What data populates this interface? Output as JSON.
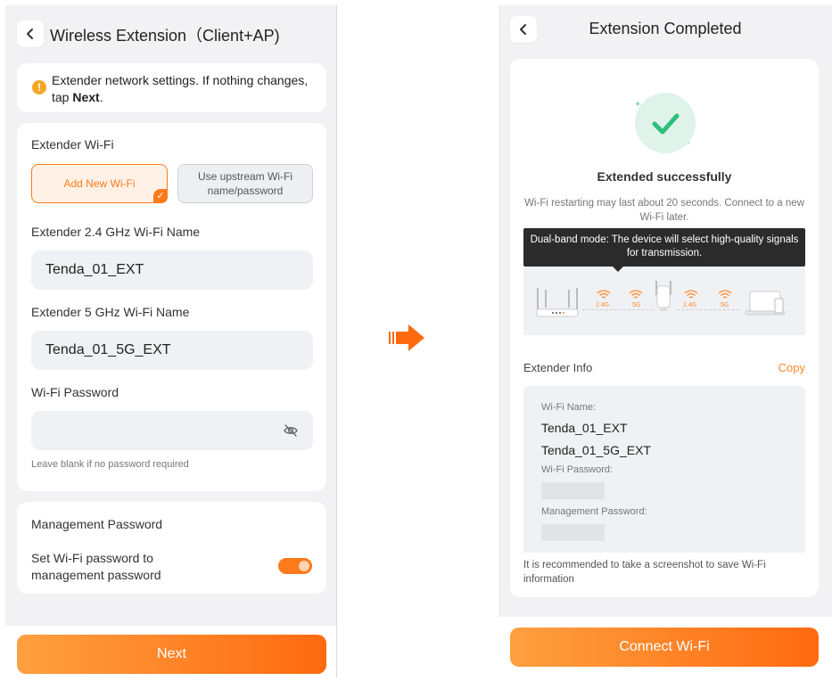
{
  "left_screen": {
    "title": "Wireless Extension（Client+AP)",
    "notice_text": "Extender network settings. If nothing changes, tap ",
    "notice_bold": "Next",
    "notice_end": ".",
    "extender_wifi_label": "Extender Wi-Fi",
    "option_add_new": "Add New Wi-Fi",
    "option_use_upstream": "Use upstream Wi-Fi name/password",
    "name_24_label": "Extender 2.4 GHz Wi-Fi Name",
    "name_24_value": "Tenda_01_EXT",
    "name_5_label": "Extender 5 GHz Wi-Fi Name",
    "name_5_value": "Tenda_01_5G_EXT",
    "password_label": "Wi-Fi Password",
    "password_value": "",
    "password_hint": "Leave blank if no password required",
    "mgmt_title": "Management Password",
    "mgmt_toggle_label": "Set Wi-Fi password to management password",
    "mgmt_toggle_on": true,
    "next_button": "Next"
  },
  "right_screen": {
    "title": "Extension Completed",
    "success_title": "Extended successfully",
    "restart_text": "Wi-Fi restarting may last about 20 seconds. Connect to a new Wi-Fi later.",
    "tooltip": "Dual-band mode: The device will select high-quality signals for transmission.",
    "band_24": "2.4G",
    "band_5": "5G",
    "info_title": "Extender Info",
    "copy_label": "Copy",
    "wifi_name_label": "Wi-Fi Name:",
    "wifi_name_24": "Tenda_01_EXT",
    "wifi_name_5": "Tenda_01_5G_EXT",
    "wifi_password_label": "Wi-Fi Password:",
    "mgmt_password_label": "Management Password:",
    "recommend_text": "It is recommended to take a screenshot to save Wi-Fi information",
    "connect_button": "Connect Wi-Fi"
  },
  "colors": {
    "accent": "#ff7a1a",
    "success": "#2dbf7a",
    "warning": "#f5a623"
  },
  "icons": {
    "back": "chevron-left-icon",
    "warning": "warning-icon",
    "check": "check-icon",
    "eye_off": "eye-off-icon",
    "arrow": "arrow-right-icon",
    "wifi": "wifi-icon",
    "router": "router-icon",
    "extender": "extender-icon",
    "laptop": "laptop-icon"
  }
}
